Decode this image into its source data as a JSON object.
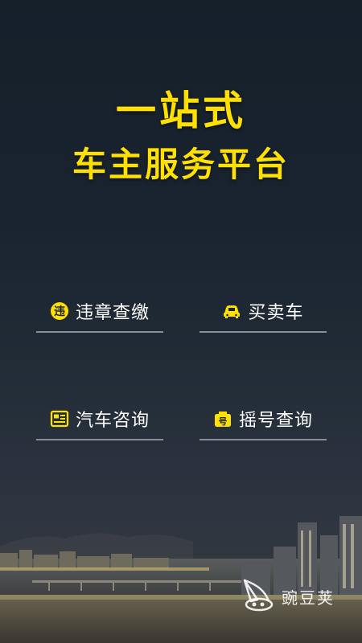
{
  "headline": {
    "line1": "一站式",
    "line2": "车主服务平台"
  },
  "features": [
    {
      "label": "违章查缴",
      "icon": "violation-badge-icon"
    },
    {
      "label": "买卖车",
      "icon": "car-icon"
    },
    {
      "label": "汽车咨询",
      "icon": "news-icon"
    },
    {
      "label": "摇号查询",
      "icon": "license-plate-icon"
    }
  ],
  "watermark": {
    "text": "豌豆荚",
    "icon": "wandoujia-logo-icon"
  },
  "colors": {
    "accent": "#ffe000",
    "text": "#ffffff",
    "divider": "#8a8f96"
  }
}
